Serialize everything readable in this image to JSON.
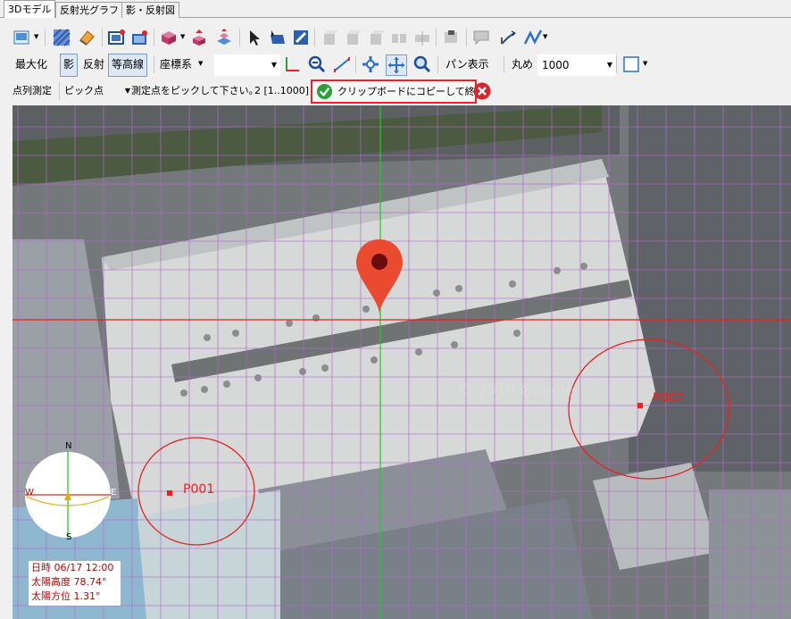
{
  "tabs": [
    "3Dモデル",
    "反射光グラフ",
    "影・反射図"
  ],
  "toolbar2": {
    "maximize": "最大化",
    "shadow": "影",
    "reflection": "反射",
    "contour": "等高線",
    "coord_system": "座標系",
    "pan_view": "パン表示",
    "rounding_label": "丸め",
    "rounding_value": "1000"
  },
  "toolbar3": {
    "mode": "点列測定",
    "pick_value": "ピック点",
    "instruction": "測定点をピックして下さい。",
    "count": "2 [1..1000]",
    "copy_finish": "クリップボードにコピーして終了"
  },
  "map": {
    "points": [
      "P001",
      "P002"
    ],
    "compass": {
      "north": "N",
      "south": "S",
      "east": "E",
      "west": "W"
    },
    "watermark": "© 2019 Google"
  },
  "sun_info": {
    "datetime": "日時 06/17 12:00",
    "altitude": "太陽高度 78.74°",
    "azimuth": "太陽方位 1.31°"
  },
  "colors": {
    "accent_red": "#e8242b",
    "grid_line": "#b06ad0",
    "axis_green": "#22cc22",
    "marker_red": "#e53935",
    "confirm_green": "#2e9e3a"
  }
}
